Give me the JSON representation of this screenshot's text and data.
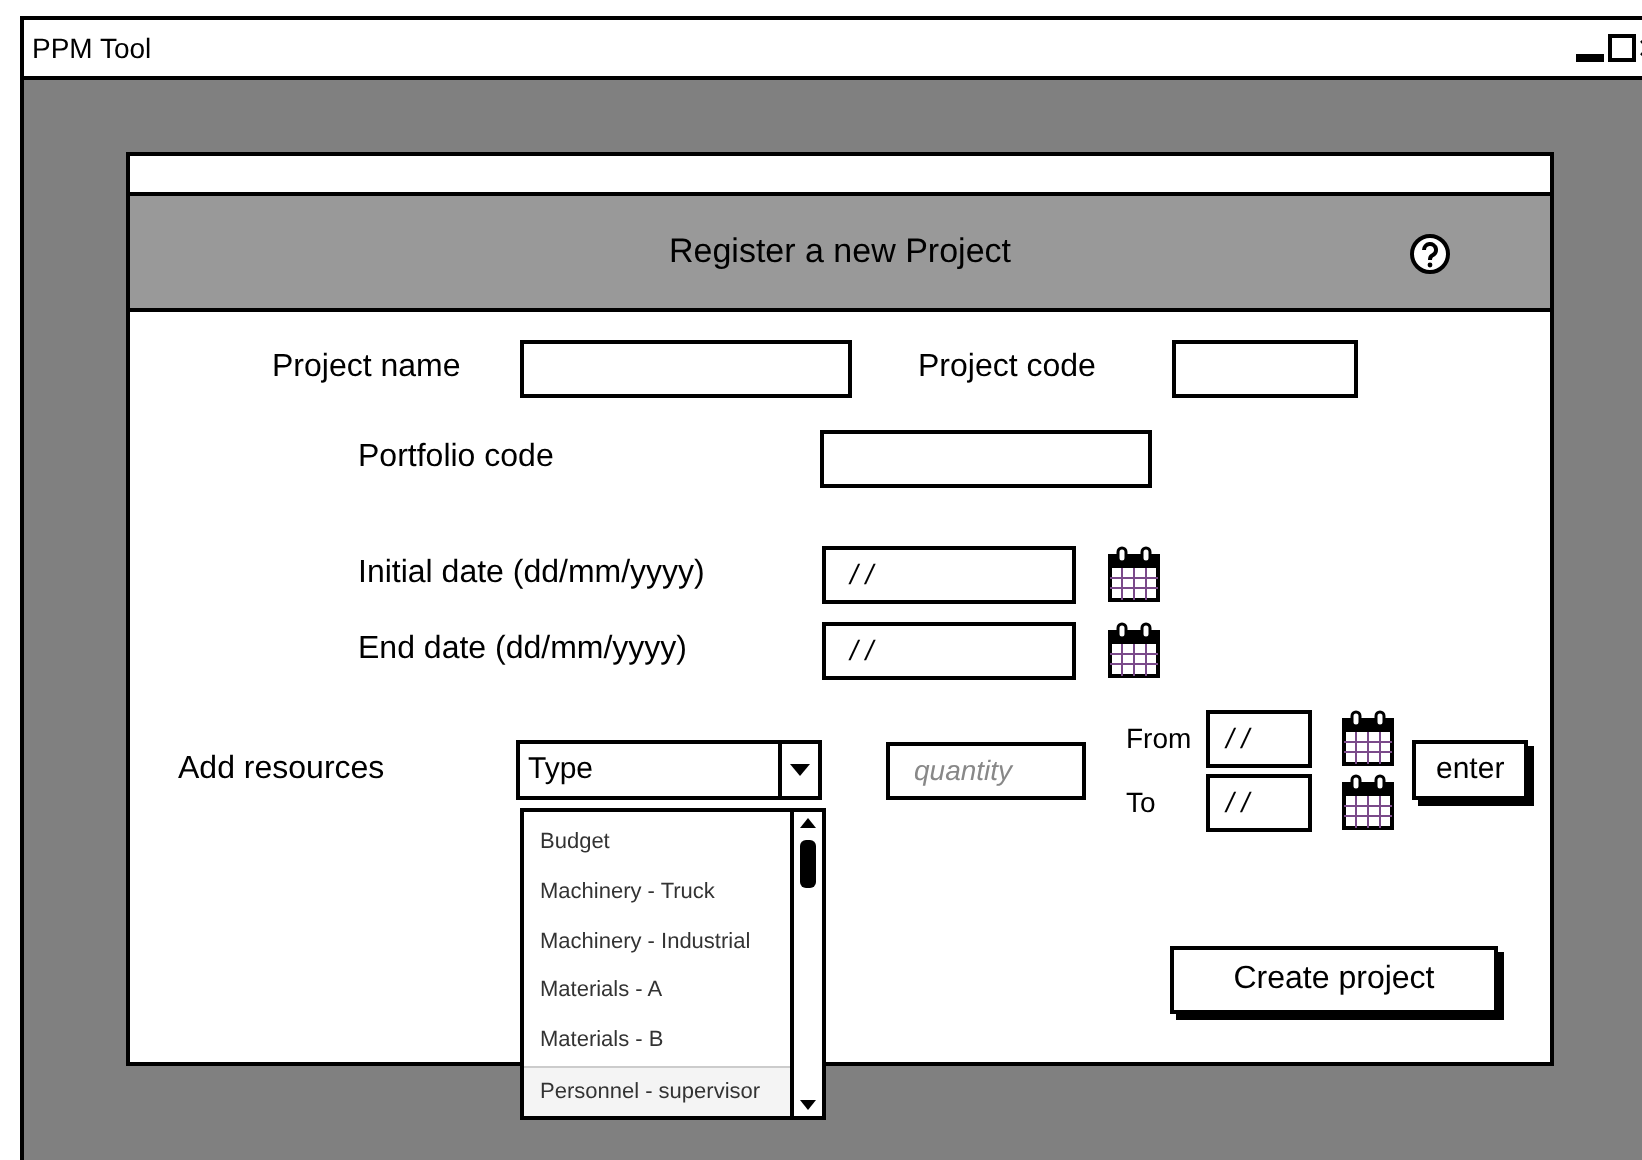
{
  "window": {
    "title": "PPM Tool"
  },
  "header": {
    "title": "Register a new Project"
  },
  "project_name": {
    "label": "Project name"
  },
  "project_code": {
    "label": "Project code"
  },
  "portfolio_code": {
    "label": "Portfolio code"
  },
  "initial_date": {
    "label": "Initial date (dd/mm/yyyy)",
    "value": "/ /"
  },
  "end_date": {
    "label": "End date (dd/mm/yyyy)",
    "value": "/ /"
  },
  "resources": {
    "label": "Add resources",
    "type_select": {
      "value": "Type",
      "expanded": true,
      "options": [
        {
          "label": "Budget",
          "selected": false
        },
        {
          "label": "Machinery - Truck",
          "selected": false
        },
        {
          "label": "Machinery - Industrial",
          "selected": false
        },
        {
          "label": "Materials - A",
          "selected": false
        },
        {
          "label": "Materials - B",
          "selected": false
        },
        {
          "label": "Personnel - supervisor",
          "selected": true
        }
      ]
    },
    "quantity": {
      "placeholder": "quantity"
    },
    "from": {
      "label": "From",
      "value": "/ /"
    },
    "to": {
      "label": "To",
      "value": "/ /"
    },
    "enter_button": "enter"
  },
  "create_button": "Create project"
}
